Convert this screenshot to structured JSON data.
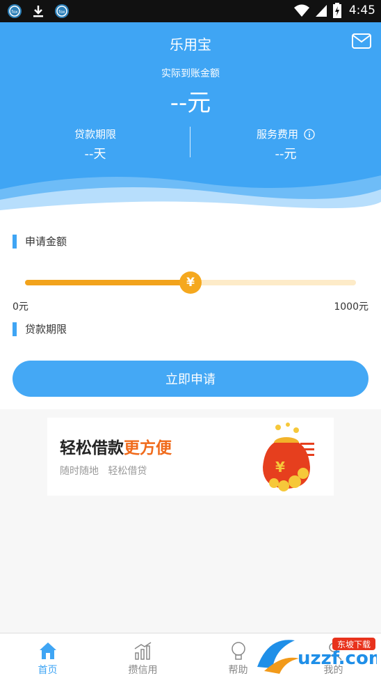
{
  "status_bar": {
    "time": "4:45",
    "icons": [
      "fox-app-icon",
      "download-icon",
      "fox-app-icon",
      "wifi-icon",
      "signal-icon",
      "battery-charging-icon"
    ]
  },
  "header": {
    "title": "乐用宝",
    "actual_amount_label": "实际到账金额",
    "actual_amount_value": "--元",
    "loan_term_label": "贷款期限",
    "loan_term_value": "--天",
    "service_fee_label": "服务费用",
    "service_fee_value": "--元",
    "colors": {
      "primary": "#3fa5f4",
      "accent": "#f2a31c"
    }
  },
  "form": {
    "apply_amount_title": "申请金额",
    "slider": {
      "min_label": "0元",
      "max_label": "1000元",
      "thumb_symbol": "¥",
      "position_fraction": 0.5
    },
    "loan_term_title": "贷款期限",
    "apply_button": "立即申请"
  },
  "banner": {
    "headline_part1": "轻松借款",
    "headline_part2": "更方便",
    "subline": "随时随地   轻松借贷",
    "bag_symbol": "¥"
  },
  "tabs": [
    {
      "label": "首页",
      "icon": "home-icon",
      "active": true
    },
    {
      "label": "攒信用",
      "icon": "chart-icon",
      "active": false
    },
    {
      "label": "帮助",
      "icon": "lightbulb-icon",
      "active": false
    },
    {
      "label": "我的",
      "icon": "user-icon",
      "active": false
    }
  ],
  "watermark": {
    "brand": "uzzf.com",
    "tag": "东坡下载"
  }
}
